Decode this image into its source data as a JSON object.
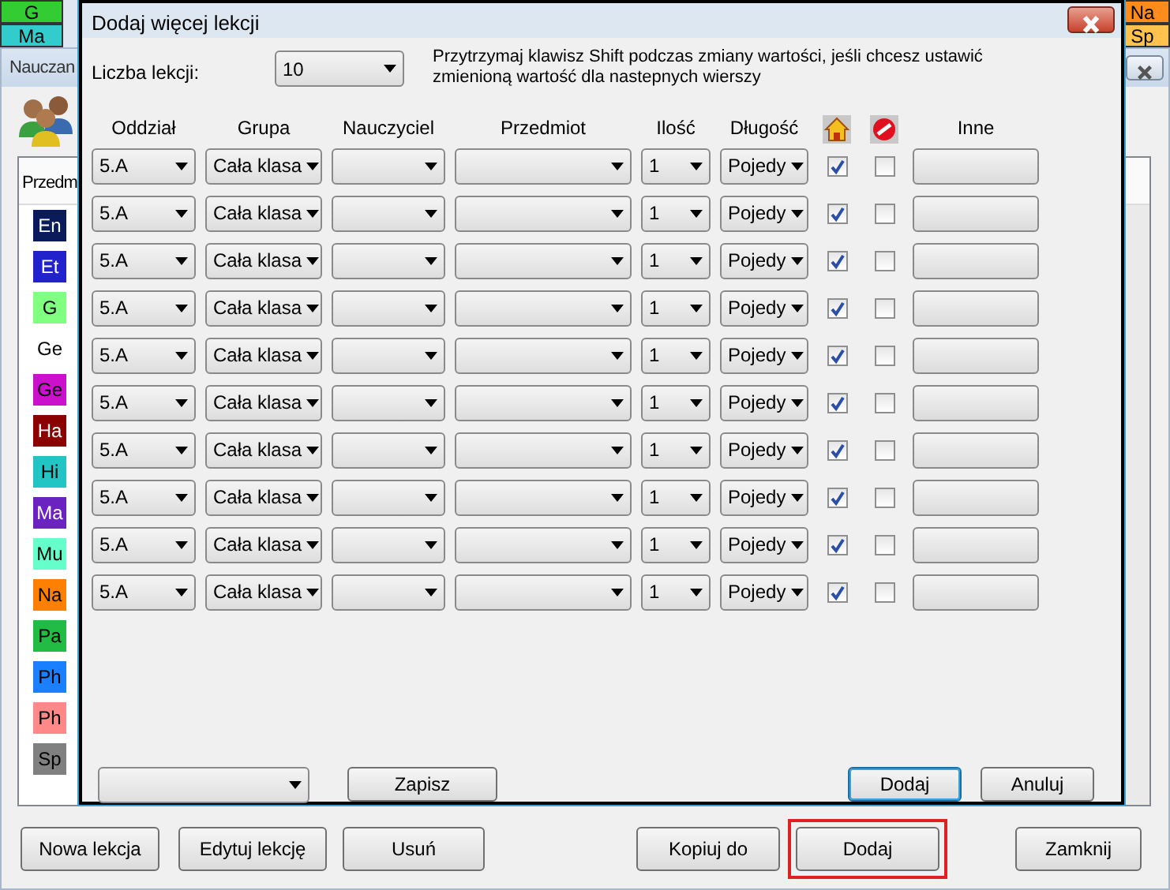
{
  "background_timetable": {
    "left_cells": [
      {
        "label": "G",
        "color": "#33cc33"
      },
      {
        "label": "Ma",
        "color": "#33cccc"
      }
    ],
    "right_cells": [
      {
        "label": "Na",
        "color": "#ff8c1a"
      },
      {
        "label": "Sp",
        "color": "#ffc24d"
      }
    ]
  },
  "main_window": {
    "title": "Nauczan",
    "list_header": "Przedm",
    "subjects": [
      {
        "label": "En",
        "color": "#0b1a5a"
      },
      {
        "label": "Et",
        "color": "#2222cc"
      },
      {
        "label": "G",
        "color": "#80ff80"
      },
      {
        "label": "Ge"
      },
      {
        "label": "Ge",
        "color": "#cc11cc"
      },
      {
        "label": "Ha",
        "color": "#8b0000"
      },
      {
        "label": "Hi",
        "color": "#22c4c4"
      },
      {
        "label": "Ma",
        "color": "#6a22c0"
      },
      {
        "label": "Mu",
        "color": "#66ffcc"
      },
      {
        "label": "Na",
        "color": "#ff8000"
      },
      {
        "label": "Pa",
        "color": "#22bb44"
      },
      {
        "label": "Ph",
        "color": "#1a80ff"
      },
      {
        "label": "Ph",
        "color": "#ff8888"
      },
      {
        "label": "Sp",
        "color": "#808080"
      }
    ],
    "buttons": [
      {
        "label": "Nowa lekcja",
        "highlighted": false
      },
      {
        "label": "Edytuj lekcję",
        "highlighted": false
      },
      {
        "label": "Usuń",
        "highlighted": false
      },
      {
        "label": "Kopiuj do",
        "highlighted": false
      },
      {
        "label": "Dodaj",
        "highlighted": true
      },
      {
        "label": "Zamknij",
        "highlighted": false
      }
    ]
  },
  "dialog": {
    "title": "Dodaj więcej lekcji",
    "count_label": "Liczba lekcji:",
    "count_value": "10",
    "hint": "Przytrzymaj klawisz Shift podczas zmiany wartości, jeśli chcesz ustawić zmienioną wartość dla nastepnych wierszy",
    "columns": [
      "Oddział",
      "Grupa",
      "Nauczyciel",
      "Przedmiot",
      "Ilość",
      "Długość",
      "Inne"
    ],
    "rows": [
      {
        "class": "5.A",
        "group": "Cała klasa",
        "count": "1",
        "length": "Pojedy",
        "home": true,
        "blocked": false
      },
      {
        "class": "5.A",
        "group": "Cała klasa",
        "count": "1",
        "length": "Pojedy",
        "home": true,
        "blocked": false
      },
      {
        "class": "5.A",
        "group": "Cała klasa",
        "count": "1",
        "length": "Pojedy",
        "home": true,
        "blocked": false
      },
      {
        "class": "5.A",
        "group": "Cała klasa",
        "count": "1",
        "length": "Pojedy",
        "home": true,
        "blocked": false
      },
      {
        "class": "5.A",
        "group": "Cała klasa",
        "count": "1",
        "length": "Pojedy",
        "home": true,
        "blocked": false
      },
      {
        "class": "5.A",
        "group": "Cała klasa",
        "count": "1",
        "length": "Pojedy",
        "home": true,
        "blocked": false
      },
      {
        "class": "5.A",
        "group": "Cała klasa",
        "count": "1",
        "length": "Pojedy",
        "home": true,
        "blocked": false
      },
      {
        "class": "5.A",
        "group": "Cała klasa",
        "count": "1",
        "length": "Pojedy",
        "home": true,
        "blocked": false
      },
      {
        "class": "5.A",
        "group": "Cała klasa",
        "count": "1",
        "length": "Pojedy",
        "home": true,
        "blocked": false
      },
      {
        "class": "5.A",
        "group": "Cała klasa",
        "count": "1",
        "length": "Pojedy",
        "home": true,
        "blocked": false
      }
    ],
    "buttons": [
      {
        "label": "Zapisz",
        "focused": false
      },
      {
        "label": "Dodaj",
        "focused": true
      },
      {
        "label": "Anuluj",
        "focused": false
      }
    ]
  }
}
